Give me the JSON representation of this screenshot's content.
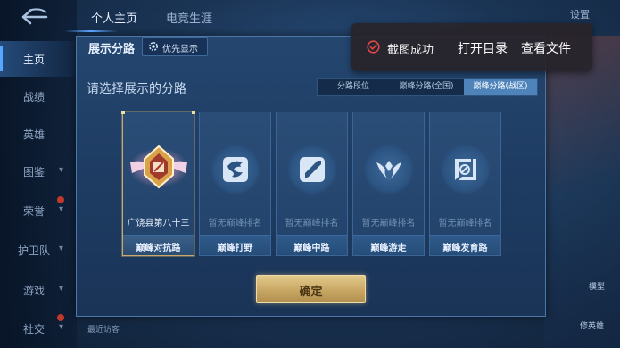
{
  "nav": {
    "items": [
      {
        "label": "主页",
        "active": true
      },
      {
        "label": "战绩"
      },
      {
        "label": "英雄"
      },
      {
        "label": "图鉴"
      },
      {
        "label": "荣誉"
      },
      {
        "label": "护卫队"
      },
      {
        "label": "游戏"
      },
      {
        "label": "社交"
      }
    ]
  },
  "top": {
    "tabs": [
      "个人主页",
      "电竞生涯"
    ],
    "settings_label": "设置"
  },
  "toast": {
    "message": "截图成功",
    "open_dir": "打开目录",
    "view_file": "查看文件"
  },
  "dialog": {
    "title": "展示分路",
    "priority_label": "优先显示",
    "subtitle": "请选择展示的分路",
    "segments": [
      "分路段位",
      "巅峰分路(全国)",
      "巅峰分路(战区)"
    ],
    "active_segment": 2,
    "cards": [
      {
        "rank": "广饶县第八十三",
        "name": "巅峰对抗路",
        "selected": true,
        "icon": "top-lane-rank-icon"
      },
      {
        "rank": "暂无巅峰排名",
        "name": "巅峰打野",
        "icon": "jungle-icon"
      },
      {
        "rank": "暂无巅峰排名",
        "name": "巅峰中路",
        "icon": "mid-lane-icon"
      },
      {
        "rank": "暂无巅峰排名",
        "name": "巅峰游走",
        "icon": "roam-icon"
      },
      {
        "rank": "暂无巅峰排名",
        "name": "巅峰发育路",
        "icon": "bot-lane-icon"
      }
    ],
    "confirm_label": "确定"
  },
  "bottom": {
    "recent_visitors": "最近访客",
    "model_label": "模型",
    "right_label": "修英雄"
  },
  "colors": {
    "accent_gold": "#c9a86a",
    "active_segment": "#4f84bb",
    "toast_success": "#e04848"
  }
}
